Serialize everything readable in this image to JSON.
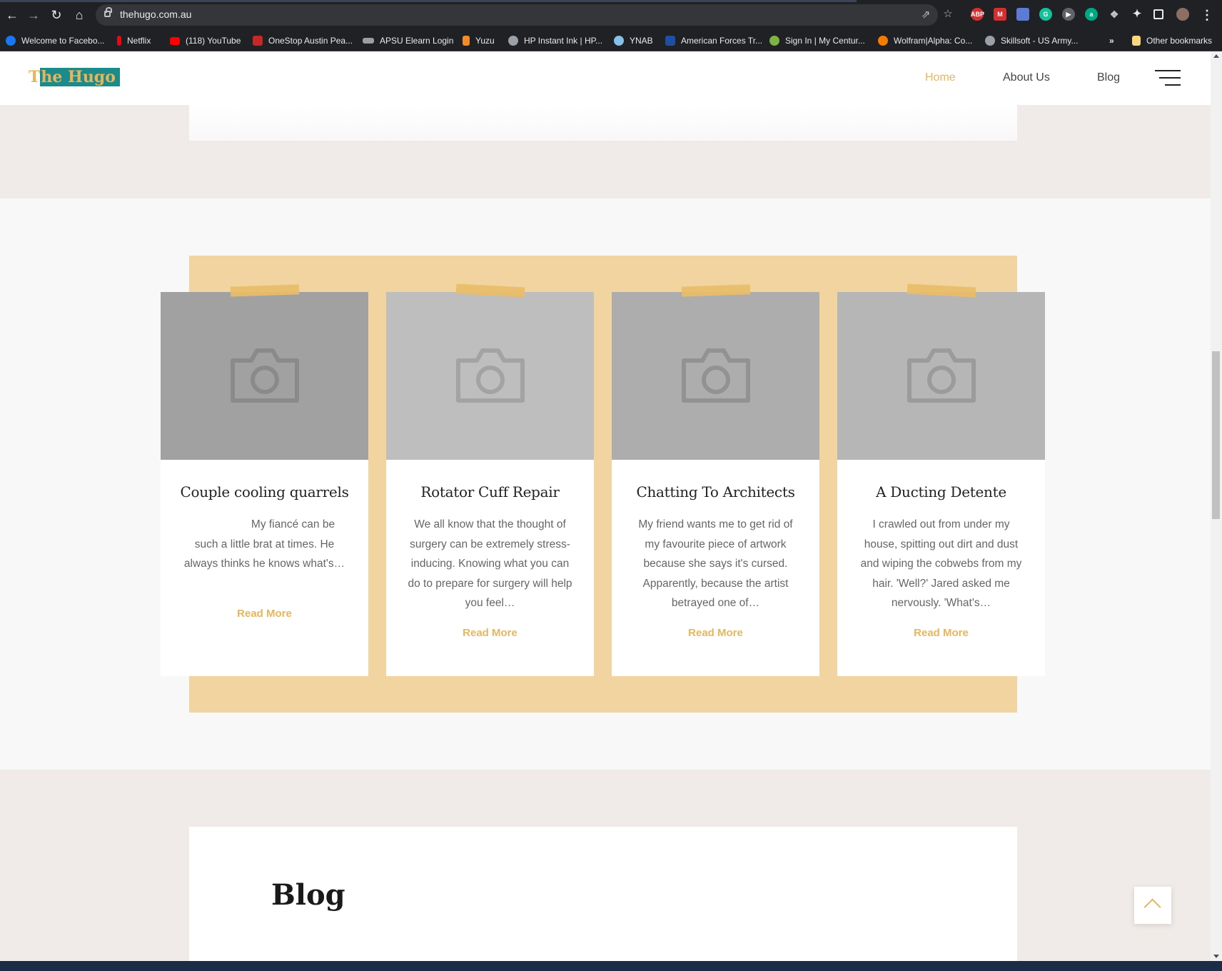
{
  "browser": {
    "url": "thehugo.com.au",
    "bookmarks": [
      {
        "label": "Welcome to Facebo...",
        "color": "#1877f2"
      },
      {
        "label": "Netflix",
        "color": "#e50914"
      },
      {
        "label": "(118) YouTube",
        "color": "#ff0000"
      },
      {
        "label": "OneStop Austin Pea...",
        "color": "#c62828"
      },
      {
        "label": "APSU Elearn Login",
        "color": "#9e9e9e"
      },
      {
        "label": "Yuzu",
        "color": "#f28c28"
      },
      {
        "label": "HP Instant Ink | HP...",
        "color": "#9aa0a6"
      },
      {
        "label": "YNAB",
        "color": "#85c1e9"
      },
      {
        "label": "American Forces Tr...",
        "color": "#1e4fa3"
      },
      {
        "label": "Sign In | My Centur...",
        "color": "#7cb342"
      },
      {
        "label": "Wolfram|Alpha: Co...",
        "color": "#f57c00"
      },
      {
        "label": "Skillsoft - US Army...",
        "color": "#9aa0a6"
      }
    ],
    "more_bookmarks": "»",
    "other_bookmarks": "Other bookmarks"
  },
  "site": {
    "logo": {
      "prefix": "T",
      "highlight": "he Hugo"
    },
    "nav": [
      {
        "label": "Home",
        "active": true
      },
      {
        "label": "About Us",
        "active": false
      },
      {
        "label": "Blog",
        "active": false
      }
    ]
  },
  "posts": [
    {
      "photo_color": "#a1a1a1",
      "title": "Couple cooling quarrels",
      "excerpt": "My fiancé can be such a little brat at times. He always thinks he knows what's…",
      "read_more": "Read More"
    },
    {
      "photo_color": "#bebebe",
      "title": "Rotator Cuff Repair",
      "excerpt": "We all know that the thought of surgery can be extremely stress-inducing. Knowing what you can do to prepare for surgery will help you feel…",
      "read_more": "Read More"
    },
    {
      "photo_color": "#adadad",
      "title": "Chatting To Architects",
      "excerpt": "My friend wants me to get rid of my favourite piece of artwork because she says it's cursed. Apparently, because the artist betrayed one of…",
      "read_more": "Read More"
    },
    {
      "photo_color": "#b6b6b6",
      "title": "A Ducting Detente",
      "excerpt": "I crawled out from under my house, spitting out dirt and dust and wiping the cobwebs from my hair. 'Well?' Jared asked me nervously. 'What's…",
      "read_more": "Read More"
    }
  ],
  "blog_section": {
    "title": "Blog"
  },
  "colors": {
    "accent": "#e6b65c",
    "panel": "#f1d49f",
    "logo_bg": "#1e8b8a"
  }
}
